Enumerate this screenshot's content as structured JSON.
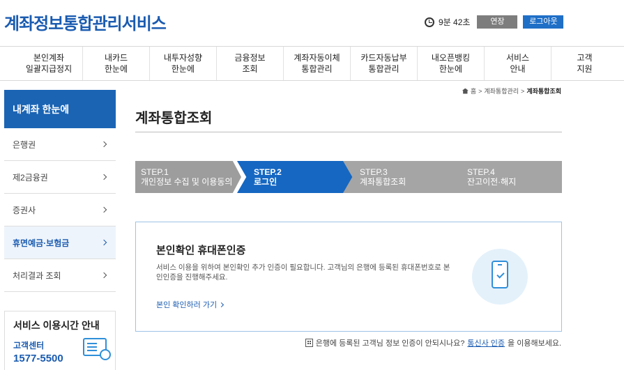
{
  "header": {
    "logo": "계좌정보통합관리서비스",
    "timer": "9분 42초",
    "extend_label": "연장",
    "logout_label": "로그아웃"
  },
  "gnb": {
    "items": [
      "본인계좌\n일괄지급정지",
      "내카드\n한눈에",
      "내투자성향\n한눈에",
      "금융정보\n조회",
      "계좌자동이체\n통합관리",
      "카드자동납부\n통합관리",
      "내오픈뱅킹\n한눈에",
      "서비스\n안내",
      "고객\n지원"
    ]
  },
  "lnb": {
    "title": "내계좌 한눈에",
    "items": [
      {
        "label": "은행권"
      },
      {
        "label": "제2금융권"
      },
      {
        "label": "증권사"
      },
      {
        "label": "휴면예금·보험금"
      },
      {
        "label": "처리결과 조회"
      }
    ]
  },
  "service_box": {
    "title": "서비스 이용시간 안내",
    "center_label": "고객센터",
    "phone": "1577-5500"
  },
  "breadcrumb": {
    "home": "홈",
    "level1": "계좌통합관리",
    "current": "계좌통합조회"
  },
  "page_title": "계좌통합조회",
  "steps": [
    {
      "num": "STEP.1",
      "label": "개인정보 수집 및 이용동의"
    },
    {
      "num": "STEP.2",
      "label": "로그인"
    },
    {
      "num": "STEP.3",
      "label": "계좌통합조회"
    },
    {
      "num": "STEP.4",
      "label": "잔고이전·해지"
    }
  ],
  "auth": {
    "title": "본인확인 휴대폰인증",
    "desc": "서비스 이용을 위하여 본인확인 추가 인증이 필요합니다. 고객님의 은행에 등록된 휴대폰번호로 본인인증을 진행해주세요.",
    "link": "본인 확인하러 가기"
  },
  "notice": {
    "text_before": "은행에 등록된 고객님 정보 인증이 안되시나요?",
    "link": "통신사 인증",
    "text_after": "을 이용해보세요."
  }
}
